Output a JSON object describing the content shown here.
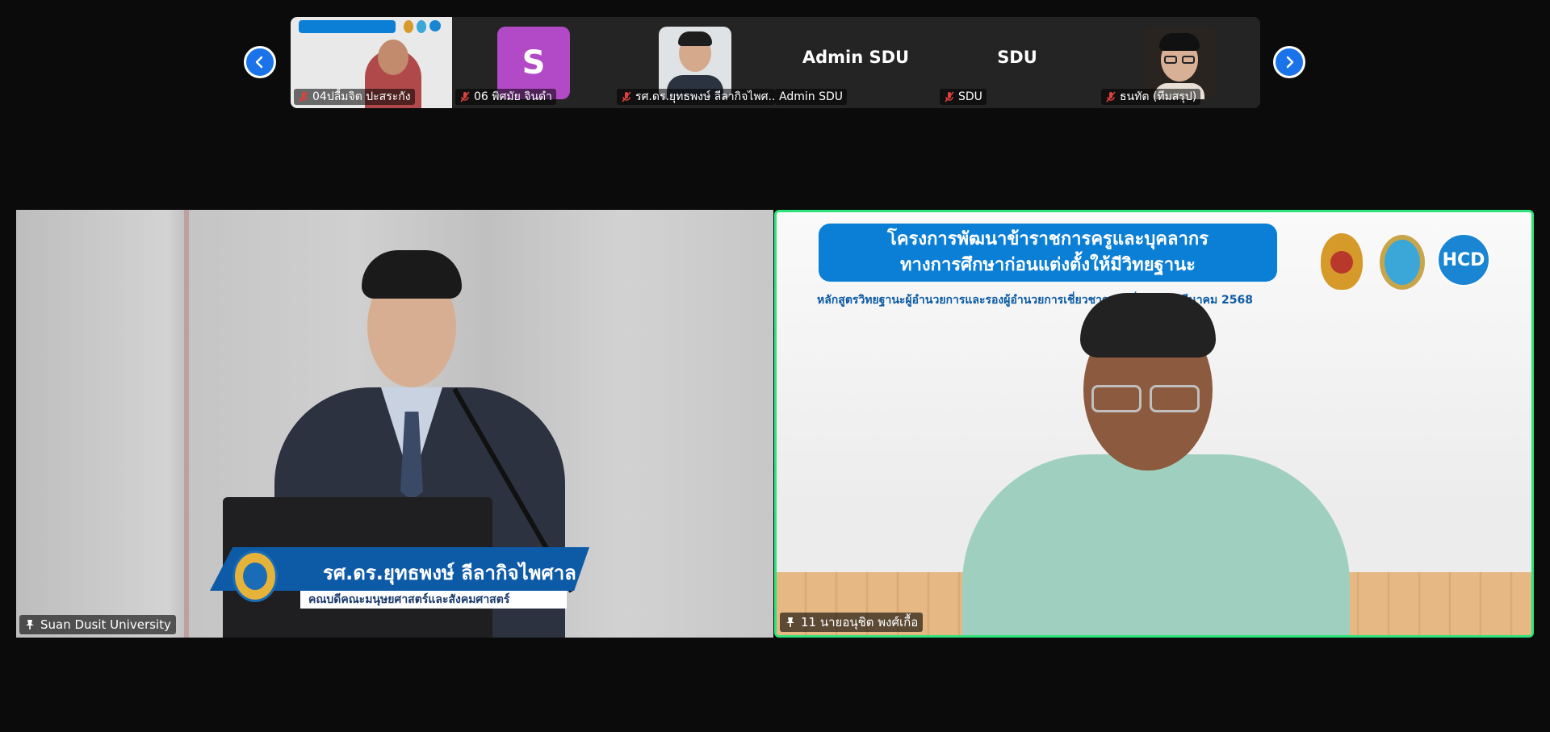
{
  "strip": {
    "tiles": [
      {
        "name": "04ปลื้มจิต ปะสระกัง"
      },
      {
        "name": "06 พิศมัย จินดำ",
        "initial": "S"
      },
      {
        "name": "รศ.ดร.ยุทธพงษ์ ลีลากิจไพศ..."
      },
      {
        "name": "Admin SDU",
        "display": "Admin SDU"
      },
      {
        "name": "SDU",
        "display": "SDU"
      },
      {
        "name": "ธนทัต (ทีมสรุป)"
      }
    ]
  },
  "main": {
    "left": {
      "label": "Suan Dusit University",
      "nameplate_name": "รศ.ดร.ยุทธพงษ์ ลีลากิจไพศาล",
      "nameplate_title": "คณบดีคณะมนุษยศาสตร์และสังคมศาสตร์"
    },
    "right": {
      "label": "11 นายอนุชิต พงศ์เกื้อ",
      "banner_line1": "โครงการพัฒนาข้าราชการครูและบุคลากร",
      "banner_line2": "ทางการศึกษาก่อนแต่งตั้งให้มีวิทยฐานะ",
      "subline": "หลักสูตรวิทยฐานะผู้อำนวยการและรองผู้อำนวยการเชี่ยวชาญ  วันที่ 25-29 มีนาคม 2568",
      "logo_text": "HCD"
    }
  },
  "colors": {
    "active_speaker_border": "#2ee37a",
    "nav_button": "#1a73e8",
    "avatar_s": "#b24ac7",
    "banner": "#0b7fd6"
  },
  "icons": [
    "chevron-left-icon",
    "chevron-right-icon",
    "mic-muted-icon",
    "pin-icon"
  ]
}
